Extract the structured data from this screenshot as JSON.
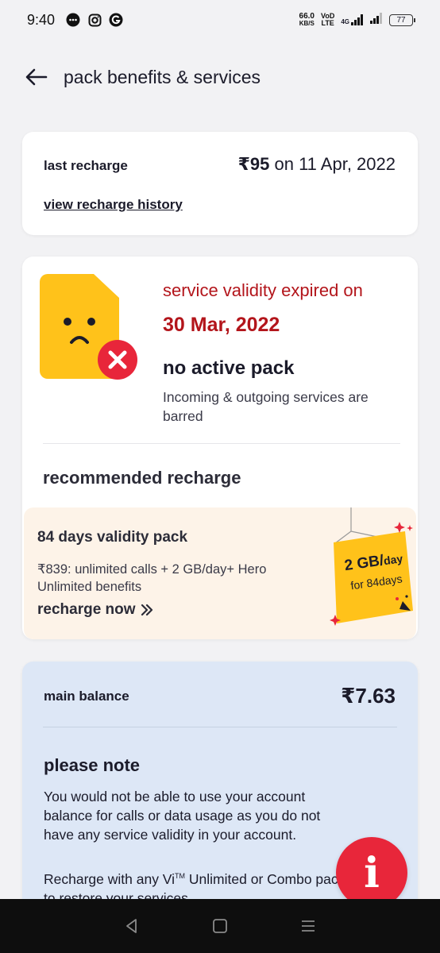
{
  "status_bar": {
    "time": "9:40",
    "net_speed_value": "66.0",
    "net_speed_unit": "KB/S",
    "volte_top": "VoD",
    "volte_bottom": "LTE",
    "network_type": "4G",
    "battery": "77",
    "notification_icons": [
      "message-icon",
      "instagram-icon",
      "g-icon"
    ]
  },
  "header": {
    "title": "pack benefits & services"
  },
  "last_recharge": {
    "label": "last recharge",
    "amount": "₹95",
    "date_text": " on 11 Apr, 2022",
    "history_link": "view recharge history"
  },
  "validity": {
    "expired_label": "service validity expired on",
    "expired_date": "30 Mar, 2022",
    "status": "no active pack",
    "note": "Incoming & outgoing services are barred",
    "recommended_title": "recommended recharge"
  },
  "offer": {
    "title": "84 days validity pack",
    "description": "₹839: unlimited calls + 2 GB/day+ Hero Unlimited benefits",
    "cta": "recharge now",
    "tag_main": "2 GB/",
    "tag_main_suffix": "day",
    "tag_sub": "for 84days"
  },
  "balance": {
    "label": "main balance",
    "value": "₹7.63",
    "note_title": "please note",
    "note_text": "You would not be able to use your account balance for calls or data usage as you do not have any service validity in your account.",
    "note_text2_a": "Recharge with any Vi",
    "note_text2_tm": "TM",
    "note_text2_b": " Unlimited or Combo pack to restore your services"
  },
  "colors": {
    "accent_red": "#b3151b",
    "fab_red": "#e8263a",
    "sim_yellow": "#ffc21a",
    "offer_bg": "#fdf3e8",
    "balance_bg": "#dde7f6"
  }
}
